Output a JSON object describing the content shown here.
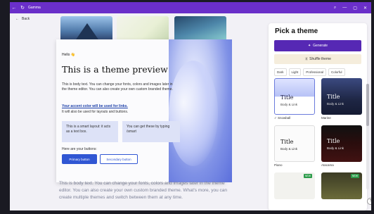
{
  "window": {
    "title": "Gamma",
    "controls": [
      "⌕",
      "—",
      "▢",
      "✕"
    ]
  },
  "nav": {
    "back_label": "Back"
  },
  "preview": {
    "hello": "Hello 👋",
    "title": "This is a theme preview",
    "body": "This is body text. You can change your fonts, colors and images later in the theme editor. You can also create your own custom branded theme.",
    "accent_link": "Your accent color will be used for links.",
    "accent_note": "It will also be used for layouts and buttons.",
    "box1": "This is a smart layout: it acts as a text box.",
    "box2": "You can get these by typing /smart",
    "buttons_label": "Here are your buttons:",
    "primary_button": "Primary button",
    "secondary_button": "Secondary button",
    "below_text": "This is body text. You can change your fonts, colors and images later in the theme editor. You can also create your own custom branded theme. What's more, you can create multiple themes and switch between them at any time."
  },
  "panel": {
    "title": "Pick a theme",
    "generate": "Generate",
    "shuffle": "Shuffle theme",
    "filters": [
      "Dark",
      "Light",
      "Professional",
      "Colorful"
    ],
    "themes": [
      {
        "name": "✓ Snowball",
        "title": "Title",
        "sub": "Body & Link"
      },
      {
        "name": "Marine",
        "title": "Title",
        "sub": "Body & Link"
      },
      {
        "name": "Piano",
        "title": "Title",
        "sub": "Body & Link"
      },
      {
        "name": "Atacama",
        "title": "Title",
        "sub": "Body & Link"
      }
    ],
    "new_badge": "NEW"
  },
  "help": "?",
  "colors": {
    "accent": "#3056d3",
    "brand": "#5628b4",
    "titlebar": "#6a2fc9"
  }
}
